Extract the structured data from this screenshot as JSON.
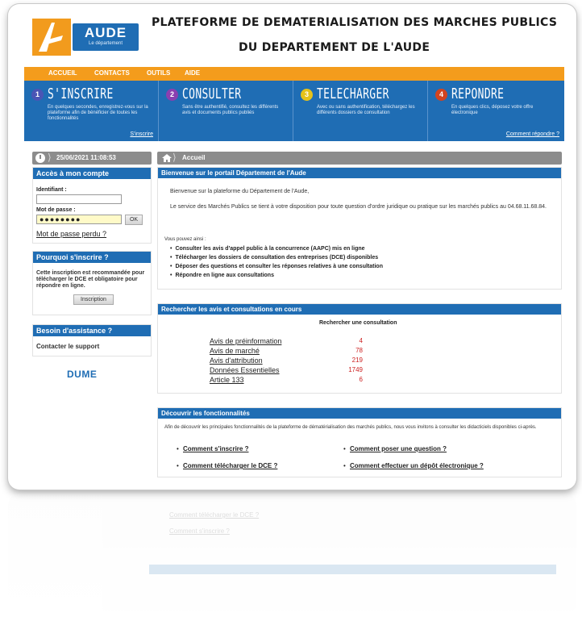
{
  "header": {
    "logo_name": "AUDE",
    "logo_sub": "Le département",
    "title_line1": "PLATEFORME DE DEMATERIALISATION DES MARCHES PUBLICS",
    "title_line2": "DU DEPARTEMENT DE L'AUDE"
  },
  "menu": {
    "items": [
      {
        "label": "ACCUEIL"
      },
      {
        "label": "CONTACTS"
      },
      {
        "label": "OUTILS"
      },
      {
        "label": "AIDE"
      }
    ]
  },
  "steps": [
    {
      "num": "1",
      "title": "S'INSCRIRE",
      "desc": "En quelques secondes, enregistrez-vous sur la plateforme afin de bénéficier de toutes les fonctionnalités",
      "link": "S'inscrire",
      "color": "#4a55b5"
    },
    {
      "num": "2",
      "title": "CONSULTER",
      "desc": "Sans être authentifié, consultez les différents avis et documents publics publiés",
      "link": "",
      "color": "#8a3fb0"
    },
    {
      "num": "3",
      "title": "TELECHARGER",
      "desc": "Avec ou sans authentification, téléchargez les différents dossiers de consultation",
      "link": "",
      "color": "#e5c21a"
    },
    {
      "num": "4",
      "title": "REPONDRE",
      "desc": "En quelques clics, déposez votre offre électronique",
      "link": "Comment répondre ?",
      "color": "#d2431f"
    }
  ],
  "left": {
    "datetime": "25/06/2021 11:08:53",
    "account": {
      "title": "Accès à mon compte",
      "id_label": "Identifiant :",
      "id_value": "",
      "pw_label": "Mot de passe :",
      "pw_value": "●●●●●●●●",
      "ok_label": "OK",
      "lost_pw": "Mot de passe perdu ?"
    },
    "why": {
      "title": "Pourquoi s'inscrire ?",
      "text": "Cette inscription est recommandée pour télécharger le DCE et obligatoire pour répondre en ligne.",
      "button": "Inscription"
    },
    "help": {
      "title": "Besoin d'assistance ?",
      "contact": "Contacter le support"
    },
    "dume": "DUME"
  },
  "main": {
    "breadcrumb": "Accueil",
    "welcome": {
      "title": "Bienvenue sur le portail Département de l'Aude",
      "p1": "Bienvenue sur la plateforme du Département de l'Aude,",
      "p2": "Le service des Marchés Publics se tient à votre disposition pour toute question d'ordre juridique ou pratique sur les marchés publics au 04.68.11.68.84.",
      "can": "Vous pouvez ainsi :",
      "bullets": [
        "Consulter les avis d'appel public à la concurrence (AAPC) mis en ligne",
        "Télécharger les dossiers de consultation des entreprises (DCE) disponibles",
        "Déposer des questions et consulter les réponses relatives à une consultation",
        "Répondre en ligne aux consultations"
      ]
    },
    "search": {
      "title": "Rechercher les avis et consultations en cours",
      "subtitle": "Rechercher une consultation",
      "rows": [
        {
          "label": "Avis de préinformation",
          "value": "4"
        },
        {
          "label": "Avis de marché",
          "value": "78"
        },
        {
          "label": "Avis d'attribution",
          "value": "219"
        },
        {
          "label": "Données Essentielles",
          "value": "1749"
        },
        {
          "label": "Article 133",
          "value": "6"
        }
      ]
    },
    "discover": {
      "title": "Découvrir les fonctionnalités",
      "intro": "Afin de découvrir les principales fonctionnalités de la plateforme de dématérialisation des marchés publics, nous vous invitons à consulter les didacticiels disponibles ci-après.",
      "links": [
        "Comment s'inscrire ?",
        "Comment poser une question ?",
        "Comment télécharger le DCE ?",
        "Comment effectuer un dépôt électronique ?"
      ]
    }
  },
  "colors": {
    "brand_blue": "#1f6db4",
    "brand_orange": "#f49c1c",
    "value_red": "#cc2222"
  }
}
